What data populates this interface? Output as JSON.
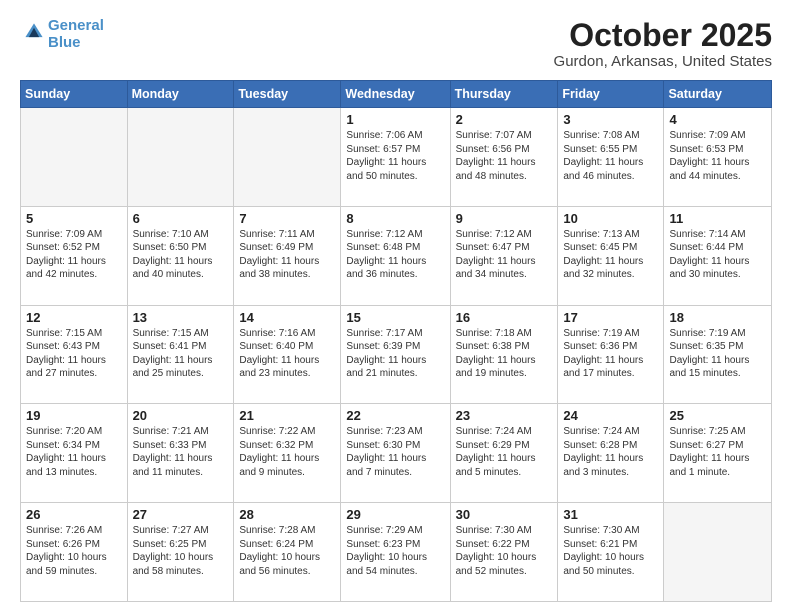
{
  "header": {
    "logo_line1": "General",
    "logo_line2": "Blue",
    "title": "October 2025",
    "subtitle": "Gurdon, Arkansas, United States"
  },
  "weekdays": [
    "Sunday",
    "Monday",
    "Tuesday",
    "Wednesday",
    "Thursday",
    "Friday",
    "Saturday"
  ],
  "weeks": [
    [
      {
        "day": "",
        "info": ""
      },
      {
        "day": "",
        "info": ""
      },
      {
        "day": "",
        "info": ""
      },
      {
        "day": "1",
        "info": "Sunrise: 7:06 AM\nSunset: 6:57 PM\nDaylight: 11 hours\nand 50 minutes."
      },
      {
        "day": "2",
        "info": "Sunrise: 7:07 AM\nSunset: 6:56 PM\nDaylight: 11 hours\nand 48 minutes."
      },
      {
        "day": "3",
        "info": "Sunrise: 7:08 AM\nSunset: 6:55 PM\nDaylight: 11 hours\nand 46 minutes."
      },
      {
        "day": "4",
        "info": "Sunrise: 7:09 AM\nSunset: 6:53 PM\nDaylight: 11 hours\nand 44 minutes."
      }
    ],
    [
      {
        "day": "5",
        "info": "Sunrise: 7:09 AM\nSunset: 6:52 PM\nDaylight: 11 hours\nand 42 minutes."
      },
      {
        "day": "6",
        "info": "Sunrise: 7:10 AM\nSunset: 6:50 PM\nDaylight: 11 hours\nand 40 minutes."
      },
      {
        "day": "7",
        "info": "Sunrise: 7:11 AM\nSunset: 6:49 PM\nDaylight: 11 hours\nand 38 minutes."
      },
      {
        "day": "8",
        "info": "Sunrise: 7:12 AM\nSunset: 6:48 PM\nDaylight: 11 hours\nand 36 minutes."
      },
      {
        "day": "9",
        "info": "Sunrise: 7:12 AM\nSunset: 6:47 PM\nDaylight: 11 hours\nand 34 minutes."
      },
      {
        "day": "10",
        "info": "Sunrise: 7:13 AM\nSunset: 6:45 PM\nDaylight: 11 hours\nand 32 minutes."
      },
      {
        "day": "11",
        "info": "Sunrise: 7:14 AM\nSunset: 6:44 PM\nDaylight: 11 hours\nand 30 minutes."
      }
    ],
    [
      {
        "day": "12",
        "info": "Sunrise: 7:15 AM\nSunset: 6:43 PM\nDaylight: 11 hours\nand 27 minutes."
      },
      {
        "day": "13",
        "info": "Sunrise: 7:15 AM\nSunset: 6:41 PM\nDaylight: 11 hours\nand 25 minutes."
      },
      {
        "day": "14",
        "info": "Sunrise: 7:16 AM\nSunset: 6:40 PM\nDaylight: 11 hours\nand 23 minutes."
      },
      {
        "day": "15",
        "info": "Sunrise: 7:17 AM\nSunset: 6:39 PM\nDaylight: 11 hours\nand 21 minutes."
      },
      {
        "day": "16",
        "info": "Sunrise: 7:18 AM\nSunset: 6:38 PM\nDaylight: 11 hours\nand 19 minutes."
      },
      {
        "day": "17",
        "info": "Sunrise: 7:19 AM\nSunset: 6:36 PM\nDaylight: 11 hours\nand 17 minutes."
      },
      {
        "day": "18",
        "info": "Sunrise: 7:19 AM\nSunset: 6:35 PM\nDaylight: 11 hours\nand 15 minutes."
      }
    ],
    [
      {
        "day": "19",
        "info": "Sunrise: 7:20 AM\nSunset: 6:34 PM\nDaylight: 11 hours\nand 13 minutes."
      },
      {
        "day": "20",
        "info": "Sunrise: 7:21 AM\nSunset: 6:33 PM\nDaylight: 11 hours\nand 11 minutes."
      },
      {
        "day": "21",
        "info": "Sunrise: 7:22 AM\nSunset: 6:32 PM\nDaylight: 11 hours\nand 9 minutes."
      },
      {
        "day": "22",
        "info": "Sunrise: 7:23 AM\nSunset: 6:30 PM\nDaylight: 11 hours\nand 7 minutes."
      },
      {
        "day": "23",
        "info": "Sunrise: 7:24 AM\nSunset: 6:29 PM\nDaylight: 11 hours\nand 5 minutes."
      },
      {
        "day": "24",
        "info": "Sunrise: 7:24 AM\nSunset: 6:28 PM\nDaylight: 11 hours\nand 3 minutes."
      },
      {
        "day": "25",
        "info": "Sunrise: 7:25 AM\nSunset: 6:27 PM\nDaylight: 11 hours\nand 1 minute."
      }
    ],
    [
      {
        "day": "26",
        "info": "Sunrise: 7:26 AM\nSunset: 6:26 PM\nDaylight: 10 hours\nand 59 minutes."
      },
      {
        "day": "27",
        "info": "Sunrise: 7:27 AM\nSunset: 6:25 PM\nDaylight: 10 hours\nand 58 minutes."
      },
      {
        "day": "28",
        "info": "Sunrise: 7:28 AM\nSunset: 6:24 PM\nDaylight: 10 hours\nand 56 minutes."
      },
      {
        "day": "29",
        "info": "Sunrise: 7:29 AM\nSunset: 6:23 PM\nDaylight: 10 hours\nand 54 minutes."
      },
      {
        "day": "30",
        "info": "Sunrise: 7:30 AM\nSunset: 6:22 PM\nDaylight: 10 hours\nand 52 minutes."
      },
      {
        "day": "31",
        "info": "Sunrise: 7:30 AM\nSunset: 6:21 PM\nDaylight: 10 hours\nand 50 minutes."
      },
      {
        "day": "",
        "info": ""
      }
    ]
  ]
}
